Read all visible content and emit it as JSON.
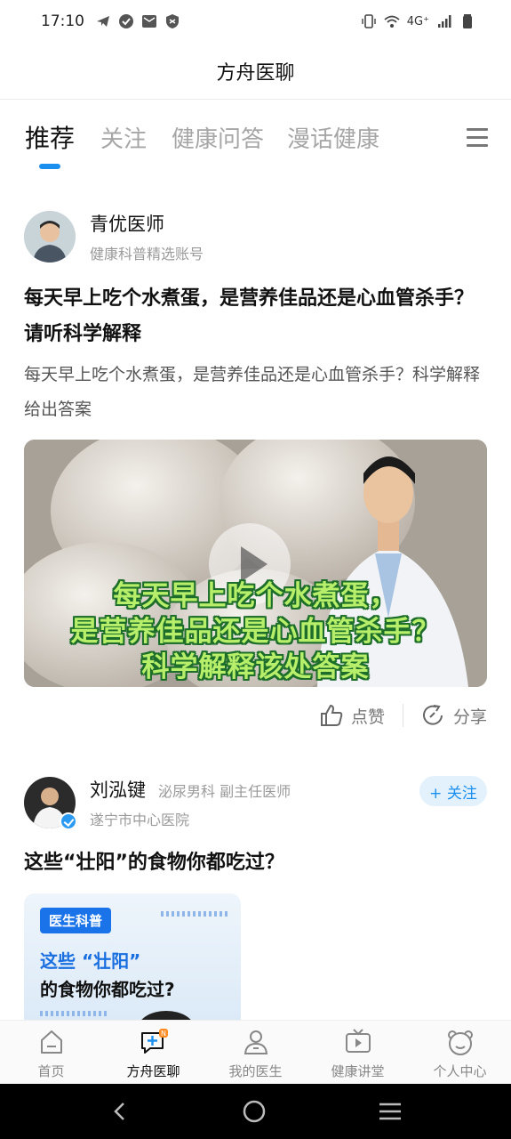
{
  "status_bar": {
    "time": "17:10",
    "network": "4G⁺"
  },
  "app": {
    "title": "方舟医聊"
  },
  "tabs": [
    {
      "label": "推荐",
      "active": true
    },
    {
      "label": "关注",
      "active": false
    },
    {
      "label": "健康问答",
      "active": false
    },
    {
      "label": "漫话健康",
      "active": false
    }
  ],
  "post1": {
    "author_name": "青优医师",
    "author_sub": "健康科普精选账号",
    "title": "每天早上吃个水煮蛋，是营养佳品还是心血管杀手？请听科学解释",
    "summary": "每天早上吃个水煮蛋，是营养佳品还是心血管杀手？科学解释给出答案",
    "video_caption": [
      "每天早上吃个水煮蛋，",
      "是营养佳品还是心血管杀手？",
      "科学解释该处答案"
    ],
    "like_label": "点赞",
    "share_label": "分享"
  },
  "post2": {
    "author_name": "刘泓键",
    "author_dept": "泌尿男科 副主任医师",
    "author_hospital": "遂宁市中心医院",
    "follow_label": "+ 关注",
    "title": "这些“壮阳”的食物你都吃过？",
    "thumb_badge": "医生科普",
    "thumb_line1": "这些 “壮阳”",
    "thumb_line2": "的食物你都吃过?"
  },
  "bottom_nav": [
    {
      "label": "首页",
      "icon": "home-icon",
      "active": false
    },
    {
      "label": "方舟医聊",
      "icon": "chat-plus-icon",
      "active": true
    },
    {
      "label": "我的医生",
      "icon": "doctor-icon",
      "active": false
    },
    {
      "label": "健康讲堂",
      "icon": "tv-icon",
      "active": false
    },
    {
      "label": "个人中心",
      "icon": "bear-icon",
      "active": false
    }
  ],
  "colors": {
    "accent": "#1a8ff0",
    "text": "#111111",
    "muted": "#9a9a9a"
  }
}
